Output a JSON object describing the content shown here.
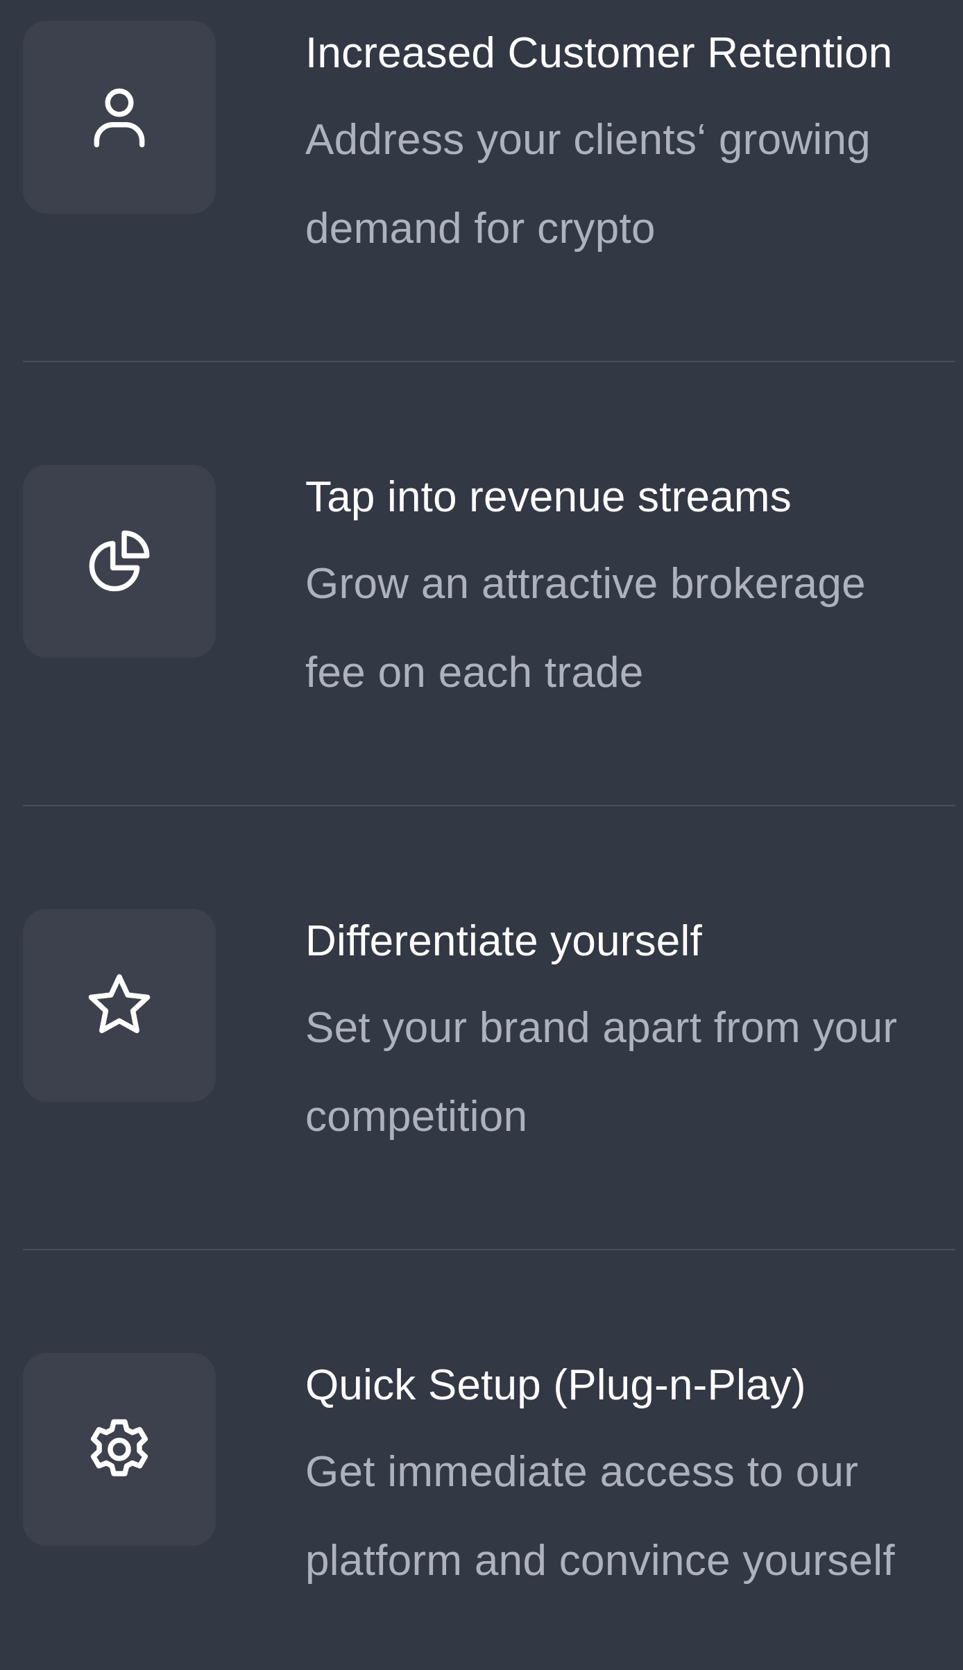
{
  "features": [
    {
      "icon": "user-icon",
      "title": "Increased Customer Retention",
      "description": "Address your clients‘ growing demand for crypto"
    },
    {
      "icon": "pie-chart-icon",
      "title": "Tap into revenue streams",
      "description": "Grow an attractive brokerage fee on each trade"
    },
    {
      "icon": "star-icon",
      "title": "Differentiate yourself",
      "description": "Set your brand apart from your competition"
    },
    {
      "icon": "gear-icon",
      "title": "Quick Setup (Plug-n-Play)",
      "description": "Get immediate access to our platform and convince yourself"
    }
  ],
  "colors": {
    "background": "#333845",
    "icon_tile": "#3c414d",
    "title": "#ffffff",
    "description": "#aeb2bf",
    "divider": "#4a4f5c"
  }
}
